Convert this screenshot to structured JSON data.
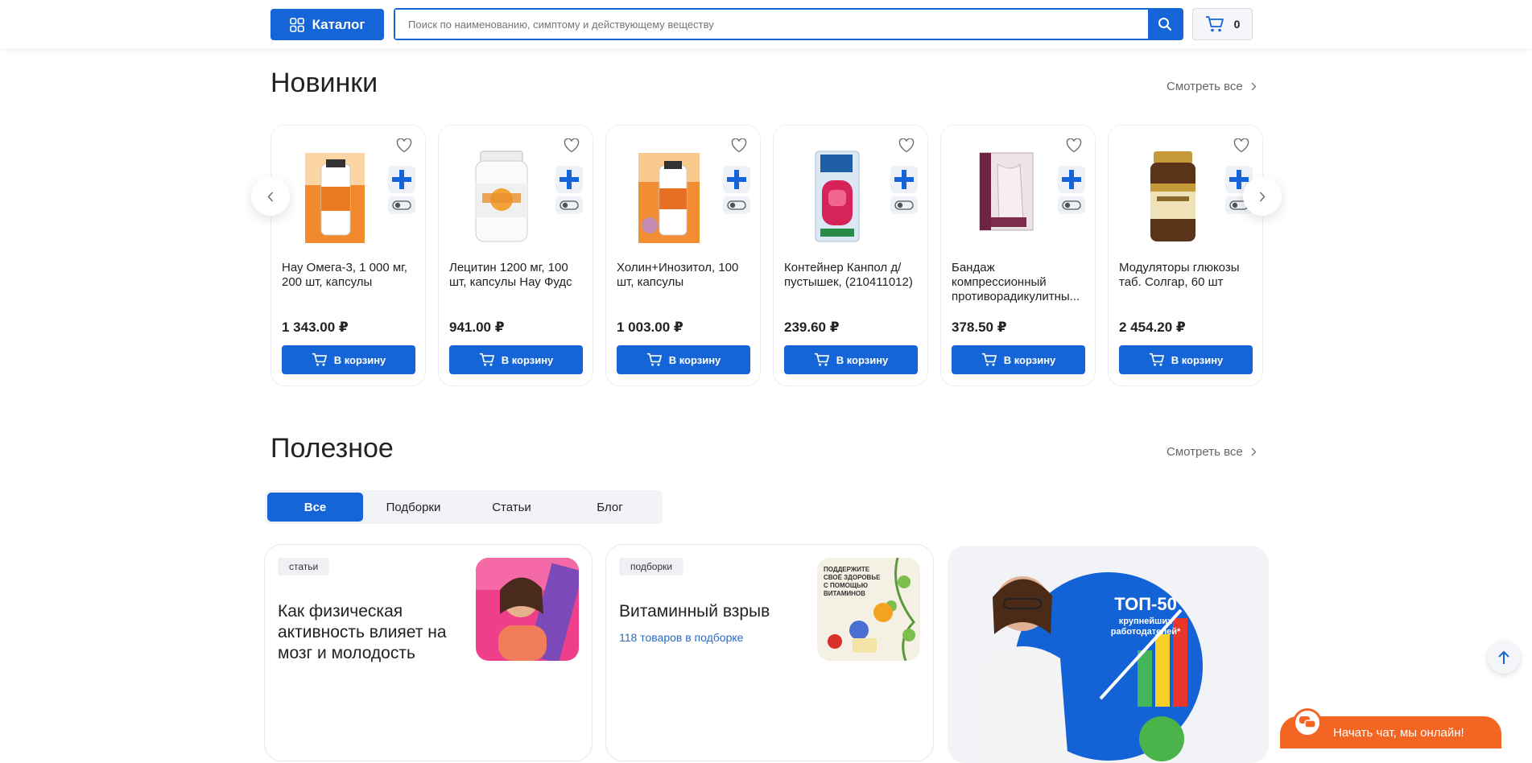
{
  "header": {
    "catalog_label": "Каталог",
    "search_placeholder": "Поиск по наименованию, симптому и действующему веществу",
    "cart_count": "0"
  },
  "new_items": {
    "title": "Новинки",
    "see_all": "Смотреть все",
    "buy_label": "В корзину",
    "products": [
      {
        "name": "Нау Омега-3, 1 000 мг, 200 шт, капсулы",
        "price": "1 343.00 ₽"
      },
      {
        "name": "Лецитин 1200 мг, 100 шт, капсулы Нау Фудс",
        "price": "941.00 ₽"
      },
      {
        "name": "Холин+Инозитол, 100 шт, капсулы",
        "price": "1 003.00 ₽"
      },
      {
        "name": "Контейнер Канпол д/пустышек, (210411012)",
        "price": "239.60 ₽"
      },
      {
        "name": "Бандаж компрессионный противорадикулитны...",
        "price": "378.50 ₽"
      },
      {
        "name": "Модуляторы глюкозы таб. Солгар, 60 шт",
        "price": "2 454.20 ₽"
      }
    ]
  },
  "useful": {
    "title": "Полезное",
    "see_all": "Смотреть все",
    "tabs": [
      "Все",
      "Подборки",
      "Статьи",
      "Блог"
    ],
    "articles": [
      {
        "badge": "статьи",
        "title": "Как физическая активность влияет на мозг и молодость"
      },
      {
        "badge": "подборки",
        "title": "Витаминный взрыв",
        "sub": "118 товаров в подборке"
      }
    ],
    "vitamin_thumb_text": "ПОДДЕРЖИТЕ СВОЁ ЗДОРОВЬЕ С ПОМОЩЬЮ ВИТАМИНОВ",
    "banner": {
      "big": "ТОП-50",
      "small": "крупнейших работодателей*"
    }
  },
  "chat": {
    "label": "Начать чат, мы онлайн!"
  },
  "colors": {
    "primary": "#1565d8",
    "chat": "#f26522"
  }
}
